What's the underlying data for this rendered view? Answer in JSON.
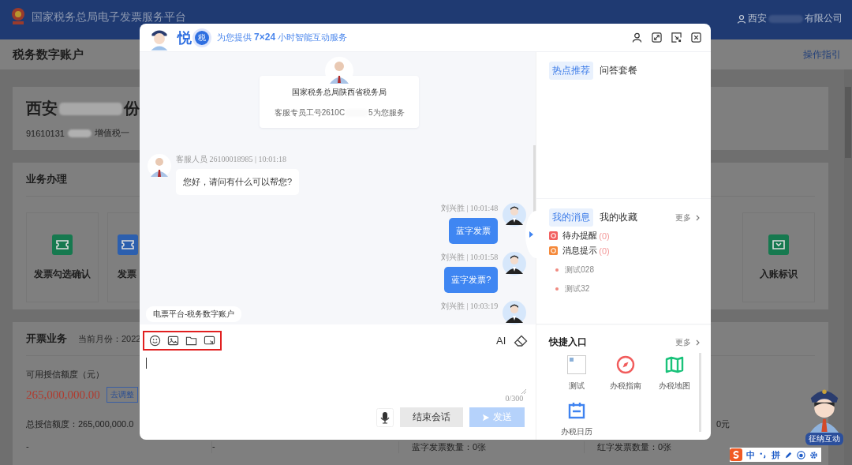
{
  "header": {
    "title": "国家税务总局电子发票服务平台",
    "user_start": "西安",
    "user_end": "有限公司"
  },
  "subheader": {
    "title": "税务数字账户",
    "guide_link": "操作指引"
  },
  "company": {
    "name_start": "西安",
    "name_end": "份",
    "tax_id": "91610131",
    "tax_type": "增值税一"
  },
  "business": {
    "title": "业务办理",
    "tiles_left": [
      {
        "label": "发票勾选确认",
        "color": "#16794f"
      },
      {
        "label": "发票",
        "color": "#2c5fae"
      }
    ],
    "tiles_right": [
      {
        "label": "入账标识",
        "color": "#16794f"
      }
    ]
  },
  "invoicing": {
    "title": "开票业务",
    "month": "当前月份：2022",
    "credit_label": "可用授信额度（元）",
    "credit_value": "265,000,000.00",
    "adjust_button": "去调整",
    "total_credit": "总授信额度：265,000,000.0",
    "amount_end": "0元",
    "cells": [
      "-",
      "-"
    ],
    "blue_count": "蓝字发票数量：0张",
    "red_count": "红字发票数量：0张"
  },
  "chat": {
    "brand": "悦",
    "badge": "税",
    "tagline": "为您提供 **7×24** 小时智能互动服务",
    "intro": {
      "org": "国家税务总局陕西省税务局",
      "agent_start": "客服专员工号2610C",
      "agent_end": "5为您服务"
    },
    "messages": [
      {
        "kind": "agent",
        "meta": "客服人员 26100018985 | 10:01:18",
        "text": "您好，请问有什么可以帮您?"
      },
      {
        "kind": "user",
        "meta": "刘兴胜 | 10:01:48",
        "text": "蓝字发票"
      },
      {
        "kind": "user",
        "meta": "刘兴胜 | 10:01:58",
        "text": "蓝字发票?"
      },
      {
        "kind": "user",
        "meta": "刘兴胜 | 10:03:19"
      }
    ],
    "context_chip": "电票平台-税务数字账户",
    "ai_button": "AI",
    "counter": "0/300",
    "end_button": "结束会话",
    "send": {
      "label": "发送",
      "disabled": true
    }
  },
  "side": {
    "hot_tabs": [
      {
        "label": "热点推荐",
        "selected": true
      },
      {
        "label": "问答套餐",
        "selected": false
      }
    ],
    "msg_tabs": [
      {
        "label": "我的消息",
        "selected": true
      },
      {
        "label": "我的收藏",
        "selected": false
      }
    ],
    "more": "更多",
    "counters": [
      {
        "label": "待办提醒",
        "count": "(0)",
        "color": "#f26161"
      },
      {
        "label": "消息提示",
        "count": "(0)",
        "color": "#f5893a"
      }
    ],
    "notices": [
      "测试028",
      "测试32"
    ],
    "quick_title": "快捷入口",
    "quick_more": "更多",
    "quick": [
      {
        "label": "测试",
        "kind": "broken"
      },
      {
        "label": "办税指南",
        "kind": "compass"
      },
      {
        "label": "办税地图",
        "kind": "map"
      },
      {
        "label": "办税日历",
        "kind": "calendar"
      }
    ]
  },
  "mascot_badge": "征纳互动",
  "ime": [
    "中",
    "拼"
  ]
}
